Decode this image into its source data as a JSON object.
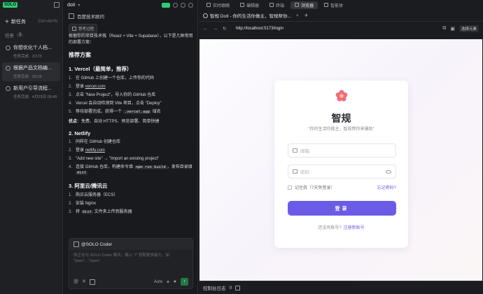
{
  "sidebar": {
    "logo": "SOLO",
    "new_task_label": "新任务",
    "new_task_shortcut": "Ctrl+Alt+N",
    "tasks_label": "任务",
    "tasks_count": "3",
    "tasks": [
      {
        "title": "你想优化个人档...",
        "status": "任务完成 · 22:23"
      },
      {
        "title": "根据产品文档编...",
        "status": "任务完成 · 20:16"
      },
      {
        "title": "新用户引导流程...",
        "status": "任务完成 · 4月23日 09:49"
      }
    ]
  },
  "chat": {
    "title": "doit",
    "sender": "百度技术顾问",
    "chip_label": "思考过程",
    "intro": "根据你的项目技术栈（React + Vite + Supabase），以下是几种常用的部署方案：",
    "recommend_heading": "推荐方案",
    "vercel": {
      "heading": "1. Vercel（最简单，推荐）",
      "steps": [
        {
          "n": "1.",
          "text": "在 GitHub 上创建一个仓库，上传你的代码"
        },
        {
          "n": "2.",
          "pre": "登录 ",
          "link": "vercel.com"
        },
        {
          "n": "3.",
          "text": "点击 \"New Project\"，导入你的 GitHub 仓库"
        },
        {
          "n": "4.",
          "text": "Vercel 会自动检测到 Vite 项目，点击 \"Deploy\""
        },
        {
          "n": "5.",
          "pre": "等待部署完成，获得一个 ",
          "code": ".vercel.app",
          "post": " 域名"
        }
      ],
      "advantages_label": "优点",
      "advantages": "：免费、自动 HTTPS、预览部署、简单快捷"
    },
    "netlify": {
      "heading": "2. Netlify",
      "steps": [
        {
          "n": "1.",
          "text": "同样在 GitHub 创建仓库"
        },
        {
          "n": "2.",
          "pre": "登录 ",
          "link": "netlify.com"
        },
        {
          "n": "3.",
          "text": "\"Add new site\" → \"Import an existing project\""
        },
        {
          "n": "4.",
          "pre": "连接 GitHub 仓库，构建命令填 ",
          "code": "npm run build",
          "post": "，发布目录填 ",
          "code2": "dist"
        }
      ]
    },
    "aliyun": {
      "heading": "3. 阿里云/腾讯云",
      "steps": [
        {
          "n": "1.",
          "text": "购买云服务器（ECS）"
        },
        {
          "n": "2.",
          "text": "安装 Nginx"
        },
        {
          "n": "3.",
          "pre": "将 ",
          "code": "dist",
          "post": " 文件夹上传到服务器"
        }
      ]
    },
    "input": {
      "agent": "@SOLO Coder",
      "placeholder": "你正在与 SOLO Coder 聊天。输入 \"/\" 获取更多能力，如 \"/plan\"、\"/spec\"",
      "mode": "Auto",
      "at_icon": "@",
      "hash_icon": "#",
      "send_icon": "↑"
    }
  },
  "browser": {
    "top_tabs": [
      "实时跟随",
      "编辑器",
      "终端",
      "浏览器",
      "智能体"
    ],
    "active_top_tab": 3,
    "page_tab_title": "智规 DoIt - 你的生活你做主，智规帮你...",
    "url": "http://localhost:5173/login",
    "select_element": "选择元素",
    "bottom_label": "控制台日志",
    "bottom_count": "0",
    "login": {
      "brand": "智规",
      "slogan": "\"你的生活你做主，智规帮你来辅助\"",
      "email_placeholder": "邮箱",
      "password_placeholder": "密码",
      "remember": "记住我（7天免登录）",
      "forgot": "忘记密码?",
      "submit": "登录",
      "no_account": "还没有账号?",
      "register": "注册新账号"
    }
  },
  "colors": {
    "accent": "#6b5ce7",
    "brand_green": "#2ecc71",
    "flower_pink": "#f06a8a"
  }
}
